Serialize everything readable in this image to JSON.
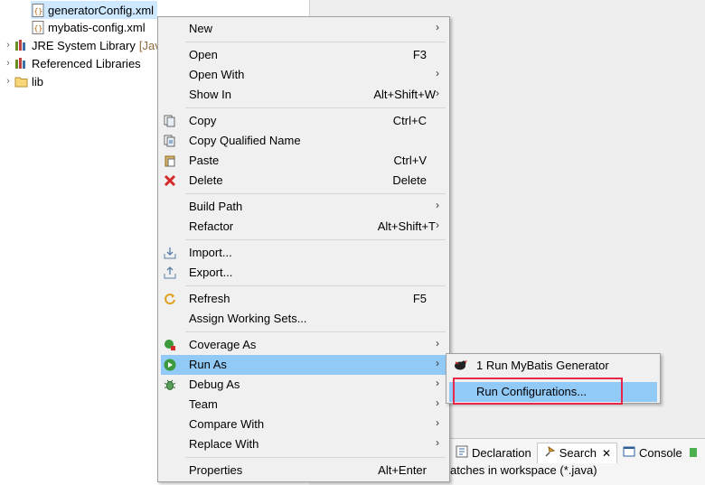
{
  "tree": {
    "items": [
      {
        "label": "generatorConfig.xml",
        "icon": "xml-file-icon",
        "selected": true
      },
      {
        "label": "mybatis-config.xml",
        "icon": "xml-file-icon"
      },
      {
        "label": "JRE System Library",
        "suffix": "[Jav",
        "icon": "library-icon"
      },
      {
        "label": "Referenced Libraries",
        "icon": "library-icon"
      },
      {
        "label": "lib",
        "icon": "folder-icon"
      }
    ]
  },
  "menu": {
    "new": {
      "label": "New"
    },
    "open": {
      "label": "Open",
      "shortcut": "F3"
    },
    "open_with": {
      "label": "Open With"
    },
    "show_in": {
      "label": "Show In",
      "shortcut": "Alt+Shift+W"
    },
    "copy": {
      "label": "Copy",
      "shortcut": "Ctrl+C"
    },
    "copy_qualified": {
      "label": "Copy Qualified Name"
    },
    "paste": {
      "label": "Paste",
      "shortcut": "Ctrl+V"
    },
    "delete": {
      "label": "Delete",
      "shortcut": "Delete"
    },
    "build_path": {
      "label": "Build Path"
    },
    "refactor": {
      "label": "Refactor",
      "shortcut": "Alt+Shift+T"
    },
    "import": {
      "label": "Import..."
    },
    "export": {
      "label": "Export..."
    },
    "refresh": {
      "label": "Refresh",
      "shortcut": "F5"
    },
    "assign_working_sets": {
      "label": "Assign Working Sets..."
    },
    "coverage_as": {
      "label": "Coverage As"
    },
    "run_as": {
      "label": "Run As"
    },
    "debug_as": {
      "label": "Debug As"
    },
    "team": {
      "label": "Team"
    },
    "compare_with": {
      "label": "Compare With"
    },
    "replace_with": {
      "label": "Replace With"
    },
    "properties": {
      "label": "Properties",
      "shortcut": "Alt+Enter"
    }
  },
  "submenu": {
    "run_mybatis": {
      "label": "1 Run MyBatis Generator"
    },
    "run_configurations": {
      "label": "Run Configurations..."
    }
  },
  "bottom_tabs": {
    "declaration": "Declaration",
    "search": "Search",
    "console": "Console"
  },
  "status_text": "atches in workspace (*.java)",
  "colors": {
    "highlight": "#91c9f7",
    "annotation_box": "#e8264a",
    "selection": "#cde8ff"
  }
}
